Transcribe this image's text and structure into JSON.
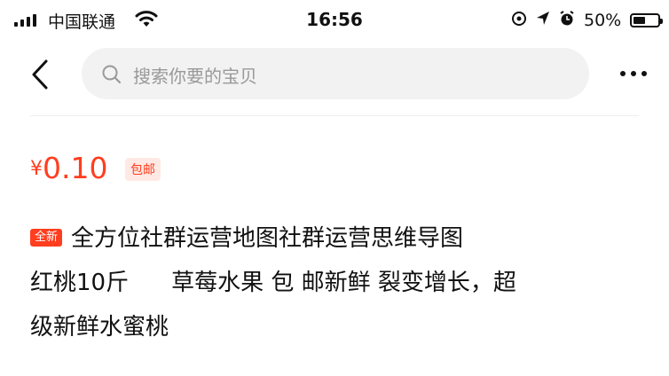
{
  "status_bar": {
    "carrier": "中国联通",
    "time": "16:56",
    "battery_percent": "50%",
    "battery_level": 0.5
  },
  "nav": {
    "back_icon": "chevron-left-icon",
    "search_icon": "search-icon",
    "search_placeholder": "搜索你要的宝贝",
    "more_icon": "more-icon"
  },
  "product": {
    "currency": "¥",
    "price": "0.10",
    "shipping_tag": "包邮",
    "condition_tag": "全新",
    "title_lines": [
      "全方位社群运营地图社群运营思维导图",
      "红桃10斤",
      "草莓水果 包  邮新鲜 裂变增长，超",
      "级新鲜水蜜桃"
    ]
  },
  "colors": {
    "accent": "#ff3e1f",
    "tag_bg": "#ffe9e5",
    "search_bg": "#f2f2f2"
  }
}
